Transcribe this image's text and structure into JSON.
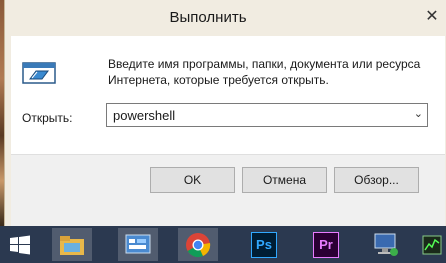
{
  "window": {
    "title": "Выполнить",
    "close_glyph": "✕"
  },
  "dialog": {
    "description_line1": "Введите имя программы, папки, документа или ресурса",
    "description_line2": "Интернета, которые требуется открыть.",
    "open_label": "Открыть:",
    "open_value": "powershell",
    "dropdown_glyph": "⌄"
  },
  "buttons": {
    "ok": "OK",
    "cancel": "Отмена",
    "browse": "Обзор..."
  },
  "taskbar": {
    "items": [
      {
        "icon": "windows-start-icon"
      },
      {
        "icon": "file-explorer-icon"
      },
      {
        "icon": "control-panel-icon"
      },
      {
        "icon": "chrome-icon"
      },
      {
        "icon": "photoshop-icon",
        "label": "Ps"
      },
      {
        "icon": "premiere-icon",
        "label": "Pr"
      },
      {
        "icon": "network-computer-icon"
      },
      {
        "icon": "resource-monitor-icon"
      }
    ]
  }
}
